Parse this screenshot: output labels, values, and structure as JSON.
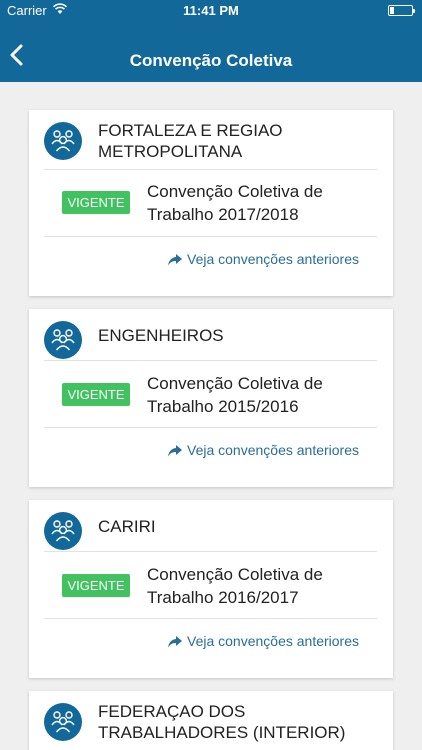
{
  "statusbar": {
    "carrier": "Carrier",
    "time": "11:41 PM",
    "icons": [
      "wifi-icon",
      "battery-icon"
    ]
  },
  "navbar": {
    "title": "Convenção Coletiva",
    "back_icon": "chevron-left-icon"
  },
  "colors": {
    "primary": "#13689a",
    "badge": "#41c15f",
    "link": "#2a6e94",
    "background": "#efefef"
  },
  "cards": [
    {
      "name": "FORTALEZA E REGIAO METROPOLITANA",
      "icon": "group-people-icon",
      "badge": "VIGENTE",
      "convention": "Convenção Coletiva de Trabalho 2017/2018",
      "link": "Veja convenções anteriores"
    },
    {
      "name": "ENGENHEIROS",
      "icon": "group-people-icon",
      "badge": "VIGENTE",
      "convention": "Convenção Coletiva de Trabalho 2015/2016",
      "link": "Veja convenções anteriores"
    },
    {
      "name": "CARIRI",
      "icon": "group-people-icon",
      "badge": "VIGENTE",
      "convention": "Convenção Coletiva de Trabalho 2016/2017",
      "link": "Veja convenções anteriores"
    },
    {
      "name": "FEDERAÇAO DOS TRABALHADORES (INTERIOR)",
      "icon": "group-people-icon"
    }
  ]
}
